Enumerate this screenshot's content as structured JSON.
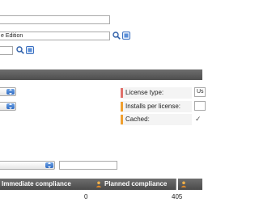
{
  "top_form": {
    "field1_value": "",
    "field2_value": "e Edition",
    "field3_value": ""
  },
  "license_panel": {
    "license_type_label": "License type:",
    "license_type_value": "Us",
    "installs_label": "Installs per license:",
    "installs_value": "",
    "cached_label": "Cached:",
    "cached_checked": true,
    "cached_check_glyph": "✓",
    "mark_colors": [
      "#e0706a",
      "#f0a030",
      "#f0a030"
    ]
  },
  "table": {
    "columns": [
      "Immediate compliance",
      "Planned compliance"
    ],
    "row": {
      "immediate": "0",
      "planned": "405"
    }
  },
  "colors": {
    "header_bar": "#5a5a5a",
    "accent_blue": "#2f6bc2"
  },
  "icons": [
    "magnifier-icon",
    "edit-icon",
    "dropdown-arrow-icon",
    "person-icon",
    "sort-icon",
    "checkbox-icon"
  ]
}
